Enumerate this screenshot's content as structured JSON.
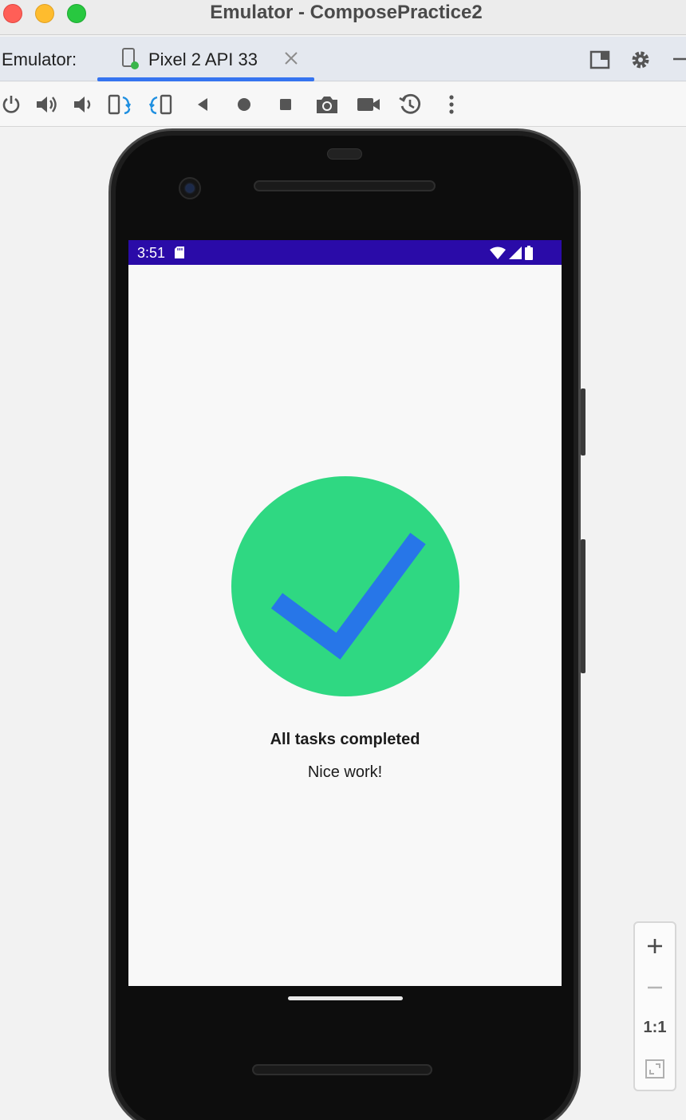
{
  "window": {
    "title": "Emulator - ComposePractice2"
  },
  "tabbar": {
    "label": "Emulator:",
    "active_tab": "Pixel 2 API 33",
    "icons": [
      "device-icon",
      "close-icon",
      "layout-icon",
      "gear-icon",
      "minimize-icon"
    ]
  },
  "toolbar": {
    "icons": [
      "power-icon",
      "volume-up-icon",
      "volume-down-icon",
      "rotate-left-icon",
      "rotate-right-icon",
      "back-icon",
      "home-icon",
      "overview-icon",
      "camera-icon",
      "screen-record-icon",
      "snapshot-icon",
      "more-icon"
    ]
  },
  "device": {
    "status_bar": {
      "time": "3:51",
      "color": "#2a0ba8"
    },
    "app": {
      "headline": "All tasks completed",
      "subtitle": "Nice work!",
      "icon": "check-circle-icon",
      "circle_color": "#2fd882",
      "check_color": "#2776e8"
    }
  },
  "zoom": {
    "one_to_one_label": "1:1",
    "icons": [
      "zoom-in-icon",
      "zoom-out-icon",
      "fit-screen-icon"
    ]
  }
}
